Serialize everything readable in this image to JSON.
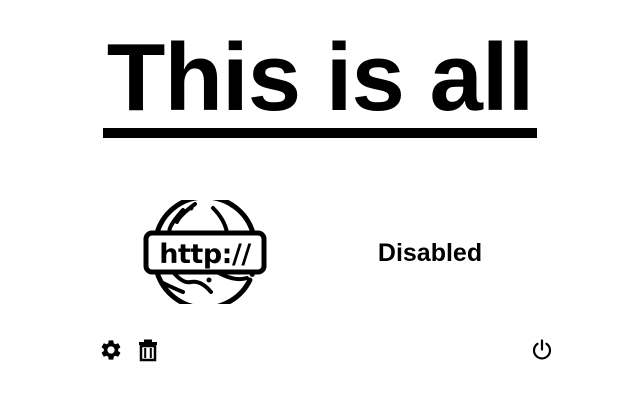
{
  "heading": "This is all",
  "site_icon": {
    "name": "http-globe-icon",
    "text": "http://"
  },
  "status": {
    "label": "Disabled"
  },
  "toolbar": {
    "settings_icon": "gear-icon",
    "delete_icon": "trash-icon",
    "power_icon": "power-icon"
  },
  "colors": {
    "background": "#ffffff",
    "foreground": "#000000"
  }
}
